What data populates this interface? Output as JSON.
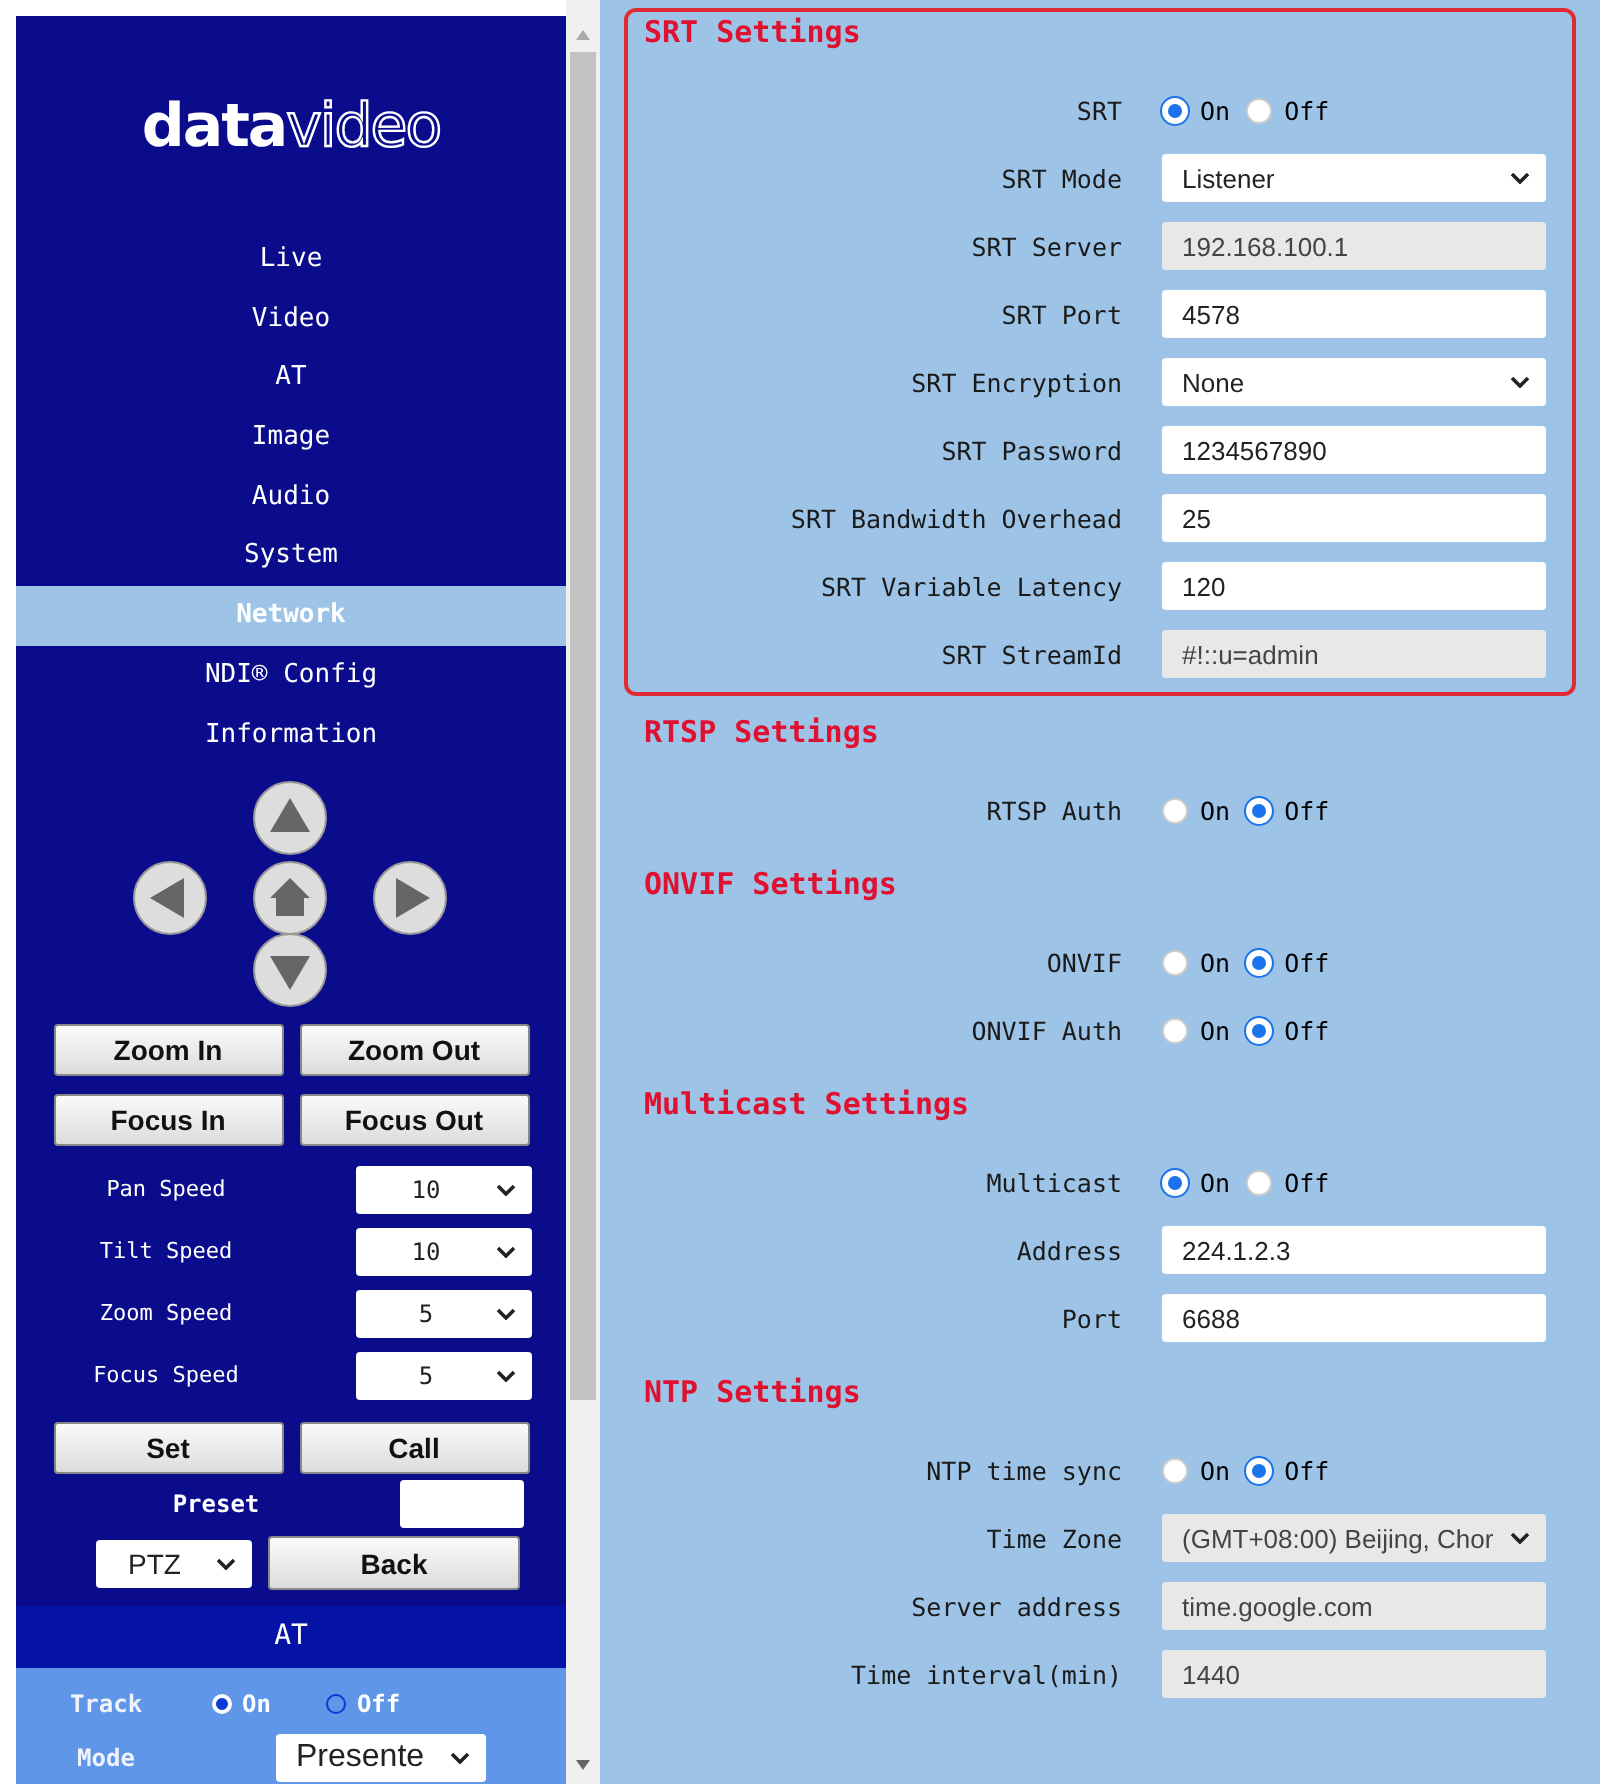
{
  "sidebar": {
    "logo": {
      "bold": "data",
      "light": "video"
    },
    "nav": [
      {
        "label": "Live",
        "selected": false
      },
      {
        "label": "Video",
        "selected": false
      },
      {
        "label": "AT",
        "selected": false
      },
      {
        "label": "Image",
        "selected": false
      },
      {
        "label": "Audio",
        "selected": false
      },
      {
        "label": "System",
        "selected": false
      },
      {
        "label": "Network",
        "selected": true
      },
      {
        "label": "NDI® Config",
        "selected": false
      },
      {
        "label": "Information",
        "selected": false
      }
    ],
    "lens_buttons": [
      "Zoom In",
      "Zoom Out",
      "Focus In",
      "Focus Out"
    ],
    "speeds": [
      {
        "label": "Pan Speed",
        "value": "10"
      },
      {
        "label": "Tilt Speed",
        "value": "10"
      },
      {
        "label": "Zoom Speed",
        "value": "5"
      },
      {
        "label": "Focus Speed",
        "value": "5"
      }
    ],
    "preset_buttons": [
      "Set",
      "Call"
    ],
    "preset_label": "Preset",
    "control_select": "PTZ",
    "back_button": "Back",
    "at": {
      "title": "AT",
      "track_label": "Track",
      "track_options": [
        {
          "label": "On",
          "selected": true
        },
        {
          "label": "Off",
          "selected": false
        }
      ],
      "mode_label": "Mode",
      "mode_value": "Presente"
    }
  },
  "sections": [
    {
      "title": "SRT Settings",
      "highlighted": true,
      "rows": [
        {
          "kind": "radio",
          "label": "SRT",
          "options": [
            {
              "label": "On",
              "selected": true
            },
            {
              "label": "Off",
              "selected": false
            }
          ]
        },
        {
          "kind": "select",
          "label": "SRT Mode",
          "value": "Listener",
          "disabled": false
        },
        {
          "kind": "text",
          "label": "SRT Server",
          "value": "192.168.100.1",
          "disabled": true
        },
        {
          "kind": "text",
          "label": "SRT Port",
          "value": "4578",
          "disabled": false
        },
        {
          "kind": "select",
          "label": "SRT Encryption",
          "value": "None",
          "disabled": false
        },
        {
          "kind": "text",
          "label": "SRT Password",
          "value": "1234567890",
          "disabled": false
        },
        {
          "kind": "text",
          "label": "SRT Bandwidth Overhead",
          "value": "25",
          "disabled": false
        },
        {
          "kind": "text",
          "label": "SRT Variable Latency",
          "value": "120",
          "disabled": false
        },
        {
          "kind": "text",
          "label": "SRT StreamId",
          "value": "#!::u=admin",
          "disabled": true
        }
      ]
    },
    {
      "title": "RTSP Settings",
      "highlighted": false,
      "rows": [
        {
          "kind": "radio",
          "label": "RTSP Auth",
          "options": [
            {
              "label": "On",
              "selected": false
            },
            {
              "label": "Off",
              "selected": true
            }
          ]
        }
      ]
    },
    {
      "title": "ONVIF Settings",
      "highlighted": false,
      "rows": [
        {
          "kind": "radio",
          "label": "ONVIF",
          "options": [
            {
              "label": "On",
              "selected": false
            },
            {
              "label": "Off",
              "selected": true
            }
          ]
        },
        {
          "kind": "radio",
          "label": "ONVIF Auth",
          "options": [
            {
              "label": "On",
              "selected": false
            },
            {
              "label": "Off",
              "selected": true
            }
          ]
        }
      ]
    },
    {
      "title": "Multicast Settings",
      "highlighted": false,
      "rows": [
        {
          "kind": "radio",
          "label": "Multicast",
          "options": [
            {
              "label": "On",
              "selected": true
            },
            {
              "label": "Off",
              "selected": false
            }
          ]
        },
        {
          "kind": "text",
          "label": "Address",
          "value": "224.1.2.3",
          "disabled": false
        },
        {
          "kind": "text",
          "label": "Port",
          "value": "6688",
          "disabled": false
        }
      ]
    },
    {
      "title": "NTP Settings",
      "highlighted": false,
      "rows": [
        {
          "kind": "radio",
          "label": "NTP time sync",
          "options": [
            {
              "label": "On",
              "selected": false
            },
            {
              "label": "Off",
              "selected": true
            }
          ]
        },
        {
          "kind": "select",
          "label": "Time Zone",
          "value": "(GMT+08:00) Beijing, Chor",
          "disabled": true
        },
        {
          "kind": "text",
          "label": "Server address",
          "value": "time.google.com",
          "disabled": true
        },
        {
          "kind": "text",
          "label": "Time interval(min)",
          "value": "1440",
          "disabled": true
        }
      ]
    }
  ]
}
